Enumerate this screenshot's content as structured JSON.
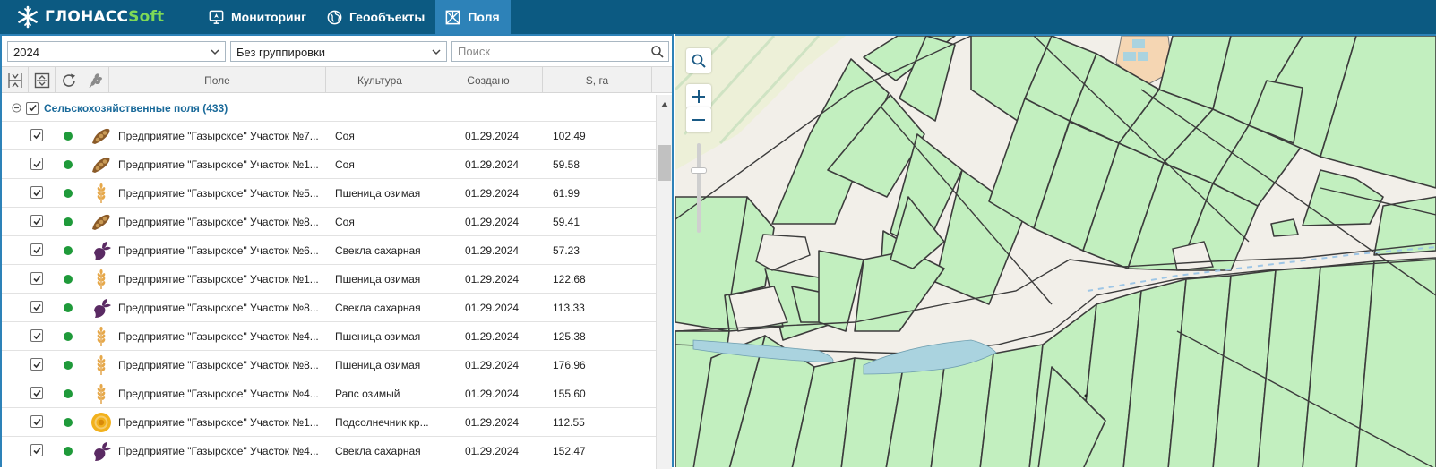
{
  "header": {
    "brand_main": "ГЛОНАСС",
    "brand_soft": "Soft",
    "nav": [
      {
        "label": "Мониторинг",
        "icon": "monitor-icon",
        "active": false
      },
      {
        "label": "Геообъекты",
        "icon": "globe-icon",
        "active": false
      },
      {
        "label": "Поля",
        "icon": "field-icon",
        "active": true
      }
    ],
    "colors": {
      "bar": "#0c5a82",
      "active": "#2d82b8",
      "soft": "#7ed957"
    }
  },
  "filters": {
    "year": "2024",
    "grouping": "Без группировки",
    "search_placeholder": "Поиск"
  },
  "table": {
    "columns": {
      "field": "Поле",
      "culture": "Культура",
      "created": "Создано",
      "area": "S, га"
    },
    "tools": [
      "collapse-rows-icon",
      "expand-rows-icon",
      "refresh-icon",
      "crop-icon"
    ],
    "group": {
      "label": "Сельскохозяйственные поля (433)",
      "checked": true
    },
    "rows": [
      {
        "name": "Предприятие \"Газырское\" Участок №7...",
        "culture": "Соя",
        "created": "01.29.2024",
        "area": "102.49",
        "crop_icon": "soy-icon"
      },
      {
        "name": "Предприятие \"Газырское\" Участок №1...",
        "culture": "Соя",
        "created": "01.29.2024",
        "area": "59.58",
        "crop_icon": "soy-icon"
      },
      {
        "name": "Предприятие \"Газырское\" Участок №5...",
        "culture": "Пшеница озимая",
        "created": "01.29.2024",
        "area": "61.99",
        "crop_icon": "wheat-icon"
      },
      {
        "name": "Предприятие \"Газырское\" Участок №8...",
        "culture": "Соя",
        "created": "01.29.2024",
        "area": "59.41",
        "crop_icon": "soy-icon"
      },
      {
        "name": "Предприятие \"Газырское\" Участок №6...",
        "culture": "Свекла сахарная",
        "created": "01.29.2024",
        "area": "57.23",
        "crop_icon": "beet-icon"
      },
      {
        "name": "Предприятие \"Газырское\" Участок №1...",
        "culture": "Пшеница озимая",
        "created": "01.29.2024",
        "area": "122.68",
        "crop_icon": "wheat-icon"
      },
      {
        "name": "Предприятие \"Газырское\" Участок №8...",
        "culture": "Свекла сахарная",
        "created": "01.29.2024",
        "area": "113.33",
        "crop_icon": "beet-icon"
      },
      {
        "name": "Предприятие \"Газырское\" Участок №4...",
        "culture": "Пшеница озимая",
        "created": "01.29.2024",
        "area": "125.38",
        "crop_icon": "wheat-icon"
      },
      {
        "name": "Предприятие \"Газырское\" Участок №8...",
        "culture": "Пшеница озимая",
        "created": "01.29.2024",
        "area": "176.96",
        "crop_icon": "wheat-icon"
      },
      {
        "name": "Предприятие \"Газырское\" Участок №4...",
        "culture": "Рапс озимый",
        "created": "01.29.2024",
        "area": "155.60",
        "crop_icon": "wheat-icon"
      },
      {
        "name": "Предприятие \"Газырское\" Участок №1...",
        "culture": "Подсолнечник кр...",
        "created": "01.29.2024",
        "area": "112.55",
        "crop_icon": "sunflower-icon"
      },
      {
        "name": "Предприятие \"Газырское\" Участок №4...",
        "culture": "Свекла сахарная",
        "created": "01.29.2024",
        "area": "152.47",
        "crop_icon": "beet-icon"
      }
    ],
    "status_color": "#1f9a3a"
  },
  "map": {
    "controls": [
      "search-icon",
      "zoom-in-icon",
      "zoom-out-icon"
    ],
    "colors": {
      "field": "#c2efbf",
      "field_dark": "#b8e8b2",
      "water": "#aad3df",
      "ground": "#f2efe9",
      "meadow": "#edf0d8"
    }
  }
}
